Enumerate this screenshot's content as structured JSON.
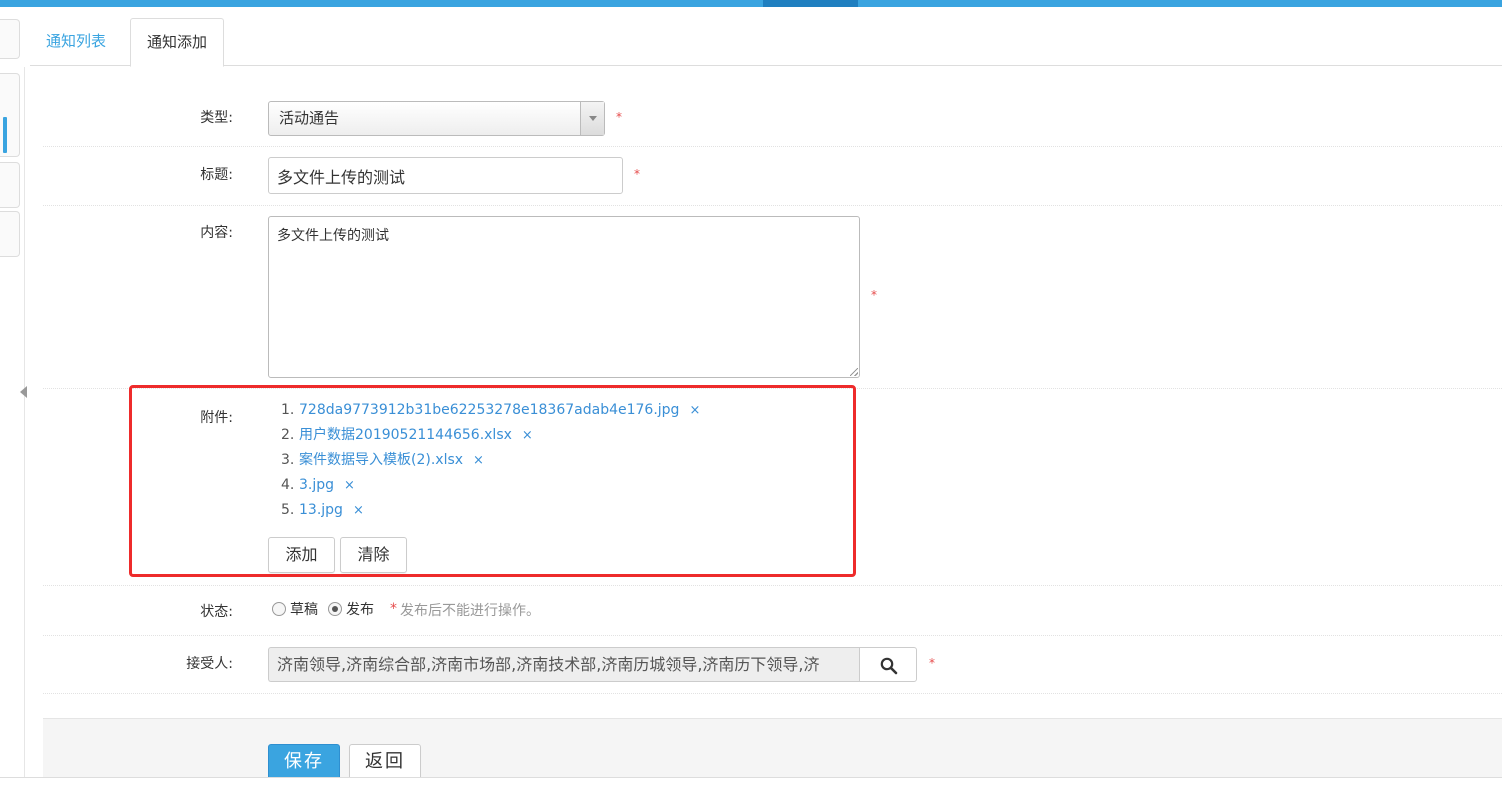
{
  "tabs": {
    "list_label": "通知列表",
    "add_label": "通知添加"
  },
  "form": {
    "type": {
      "label": "类型:",
      "value": "活动通告",
      "required": "*"
    },
    "title": {
      "label": "标题:",
      "value": "多文件上传的测试",
      "required": "*"
    },
    "content": {
      "label": "内容:",
      "value": "多文件上传的测试",
      "required": "*"
    },
    "attachments": {
      "label": "附件:",
      "items": [
        {
          "num": "1.",
          "name": "728da9773912b31be62253278e18367adab4e176.jpg",
          "delete": "×"
        },
        {
          "num": "2.",
          "name": "用户数据20190521144656.xlsx",
          "delete": "×"
        },
        {
          "num": "3.",
          "name": "案件数据导入模板(2).xlsx",
          "delete": "×"
        },
        {
          "num": "4.",
          "name": "3.jpg",
          "delete": "×"
        },
        {
          "num": "5.",
          "name": "13.jpg",
          "delete": "×"
        }
      ],
      "add_label": "添加",
      "clear_label": "清除"
    },
    "status": {
      "label": "状态:",
      "options": [
        "草稿",
        "发布"
      ],
      "selected": "发布",
      "hint_star": "*",
      "hint": "发布后不能进行操作。"
    },
    "receiver": {
      "label": "接受人:",
      "value": "济南领导,济南综合部,济南市场部,济南技术部,济南历城领导,济南历下领导,济",
      "required": "*"
    }
  },
  "actions": {
    "save_label": "保存",
    "back_label": "返回"
  },
  "colors": {
    "accent": "#3aa4e0",
    "link": "#3a8fd6",
    "required": "#e64c4c",
    "highlight": "#ee2b2b"
  }
}
